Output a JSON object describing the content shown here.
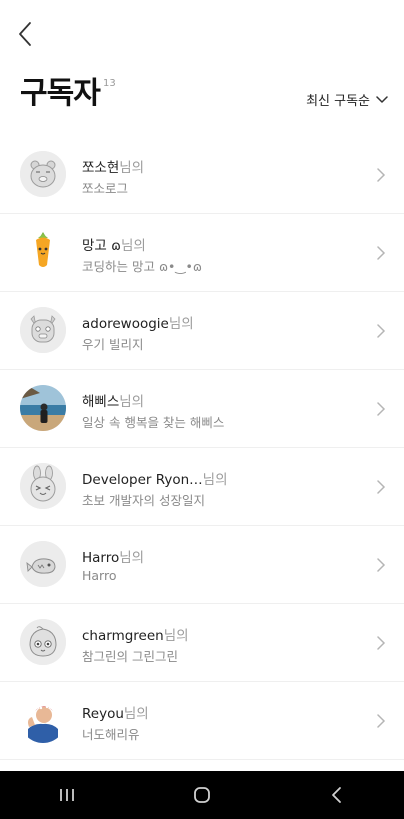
{
  "header": {
    "title": "구독자",
    "count": "13",
    "sort_label": "최신 구독순"
  },
  "subscribers": [
    {
      "name": "쪼소현",
      "suffix": "님의",
      "sub": "쪼소로그",
      "avatar": "ryan-face-icon"
    },
    {
      "name": "망고 ɷ",
      "suffix": "님의",
      "sub": "코딩하는 망고 ɷ•‿•ɷ",
      "avatar": "carrot-character-icon"
    },
    {
      "name": "adorewoogie",
      "suffix": "님의",
      "sub": "우기 빌리지",
      "avatar": "frodo-dog-face-icon"
    },
    {
      "name": "해삐스",
      "suffix": "님의",
      "sub": "일상 속 행복을 찾는 해삐스",
      "avatar": "photo-sea-person-icon"
    },
    {
      "name": "Developer Ryon…",
      "suffix": "님의",
      "sub": "초보 개발자의 성장일지",
      "avatar": "rabbit-face-icon"
    },
    {
      "name": "Harro",
      "suffix": "님의",
      "sub": "Harro",
      "avatar": "fish-character-icon"
    },
    {
      "name": "charmgreen",
      "suffix": "님의",
      "sub": "참그린의 그린그린",
      "avatar": "peach-character-icon"
    },
    {
      "name": "Reyou",
      "suffix": "님의",
      "sub": "너도해리유",
      "avatar": "rosie-riveter-icon"
    }
  ],
  "colors": {
    "background": "#ffffff",
    "divider": "#efefef",
    "text": "#222222",
    "muted": "#8a8a8a",
    "navbar": "#000000"
  }
}
